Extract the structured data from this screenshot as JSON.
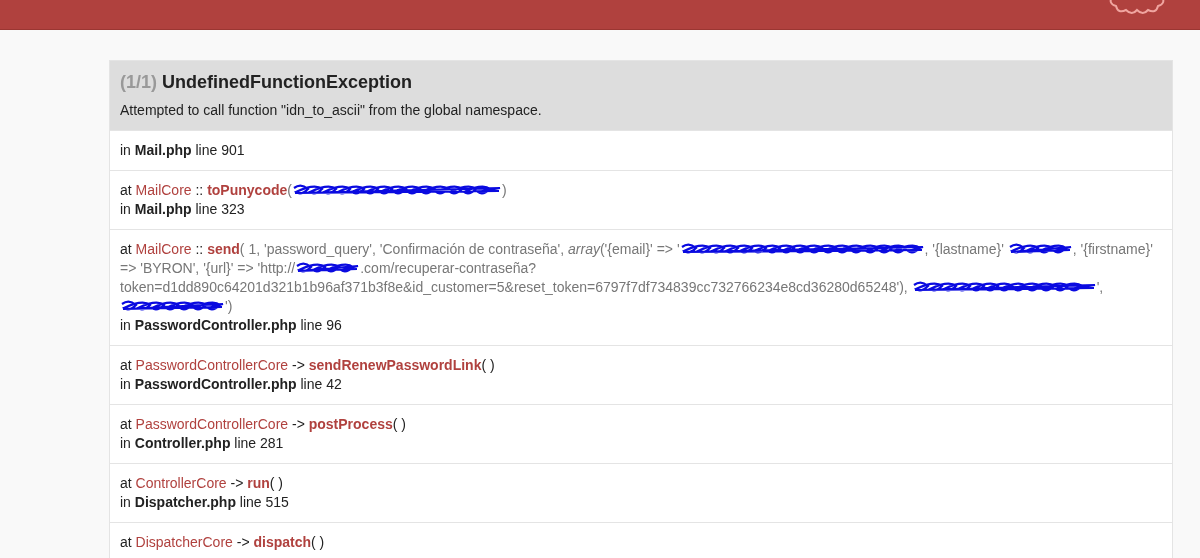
{
  "exception": {
    "counter": "(1/1)",
    "class": "UndefinedFunctionException",
    "message": "Attempted to call function \"idn_to_ascii\" from the global namespace."
  },
  "trace": [
    {
      "kind": "location",
      "in": "in",
      "file": "Mail.php",
      "line": "line 901"
    },
    {
      "kind": "call",
      "at": "at",
      "class": "MailCore",
      "type": "::",
      "function": "toPunycode",
      "open": "(",
      "close": ")",
      "args": [
        {
          "kind": "redacted"
        }
      ],
      "in": "in",
      "file": "Mail.php",
      "line": "line 323"
    },
    {
      "kind": "call",
      "at": "at",
      "class": "MailCore",
      "type": "::",
      "function": "send",
      "open": "(",
      "args": [
        {
          "kind": "text",
          "text": " 1, 'password_query', 'Confirmación de contraseña', "
        },
        {
          "kind": "italic",
          "text": "array"
        },
        {
          "kind": "text",
          "text": "('{email}' => '"
        },
        {
          "kind": "redacted"
        },
        {
          "kind": "text",
          "text": ", '{lastname}' "
        },
        {
          "kind": "redacted"
        },
        {
          "kind": "text",
          "text": ", '{firstname}' => 'BYRON', '{url}' => 'http://"
        },
        {
          "kind": "redacted"
        },
        {
          "kind": "text",
          "text": ".com/recuperar-contraseña?token=d1dd890c64201d321b1b96af371b3f8e&id_customer=5&reset_token=6797f7df734839cc732766234e8cd36280d65248'), "
        },
        {
          "kind": "redacted"
        },
        {
          "kind": "text",
          "text": "', "
        },
        {
          "kind": "redacted"
        },
        {
          "kind": "text",
          "text": "')"
        }
      ],
      "in": "in",
      "file": "PasswordController.php",
      "line": "line 96"
    },
    {
      "kind": "call",
      "at": "at",
      "class": "PasswordControllerCore",
      "type": "->",
      "function": "sendRenewPasswordLink",
      "open": "(",
      "close": " )",
      "in": "in",
      "file": "PasswordController.php",
      "line": "line 42"
    },
    {
      "kind": "call",
      "at": "at",
      "class": "PasswordControllerCore",
      "type": "->",
      "function": "postProcess",
      "open": "(",
      "close": " )",
      "in": "in",
      "file": "Controller.php",
      "line": "line 281"
    },
    {
      "kind": "call",
      "at": "at",
      "class": "ControllerCore",
      "type": "->",
      "function": "run",
      "open": "(",
      "close": " )",
      "in": "in",
      "file": "Dispatcher.php",
      "line": "line 515"
    },
    {
      "kind": "call",
      "at": "at",
      "class": "DispatcherCore",
      "type": "->",
      "function": "dispatch",
      "open": "(",
      "close": " )"
    }
  ]
}
